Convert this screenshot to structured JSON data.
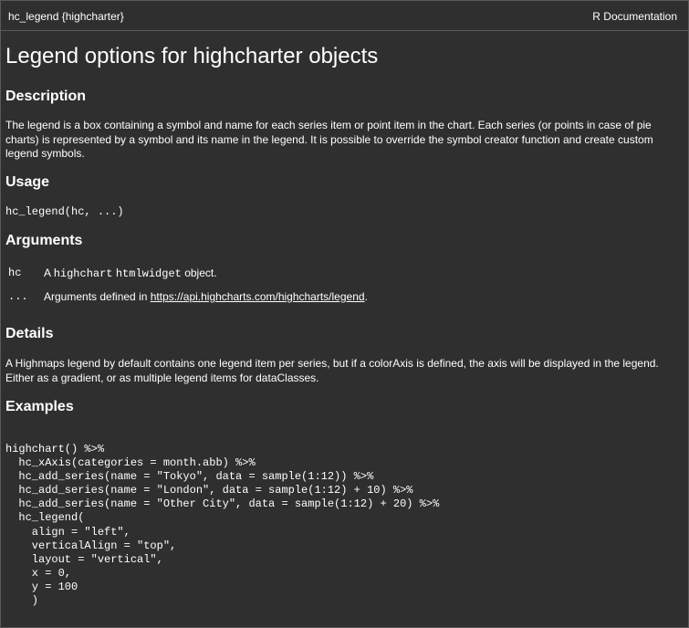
{
  "header": {
    "topic": "hc_legend {highcharter}",
    "right_label": "R Documentation"
  },
  "title": "Legend options for highcharter objects",
  "sections": {
    "description_heading": "Description",
    "description_text": "The legend is a box containing a symbol and name for each series item or point item in the chart. Each series (or points in case of pie charts) is represented by a symbol and its name in the legend. It is possible to override the symbol creator function and create custom legend symbols.",
    "usage_heading": "Usage",
    "usage_code": "hc_legend(hc, ...)",
    "arguments_heading": "Arguments",
    "details_heading": "Details",
    "details_text": "A Highmaps legend by default contains one legend item per series, but if a colorAxis is defined, the axis will be displayed in the legend. Either as a gradient, or as multiple legend items for dataClasses.",
    "examples_heading": "Examples"
  },
  "arguments": [
    {
      "name": "hc",
      "desc_prefix": "A ",
      "desc_code1": "highchart",
      "desc_space": " ",
      "desc_code2": "htmlwidget",
      "desc_suffix": " object."
    },
    {
      "name": "...",
      "desc_prefix": "Arguments defined in ",
      "link": "https://api.highcharts.com/highcharts/legend",
      "desc_suffix": "."
    }
  ],
  "example_code": "highchart() %>%\n  hc_xAxis(categories = month.abb) %>%\n  hc_add_series(name = \"Tokyo\", data = sample(1:12)) %>%\n  hc_add_series(name = \"London\", data = sample(1:12) + 10) %>%\n  hc_add_series(name = \"Other City\", data = sample(1:12) + 20) %>%\n  hc_legend(\n    align = \"left\",\n    verticalAlign = \"top\",\n    layout = \"vertical\",\n    x = 0,\n    y = 100\n    )"
}
